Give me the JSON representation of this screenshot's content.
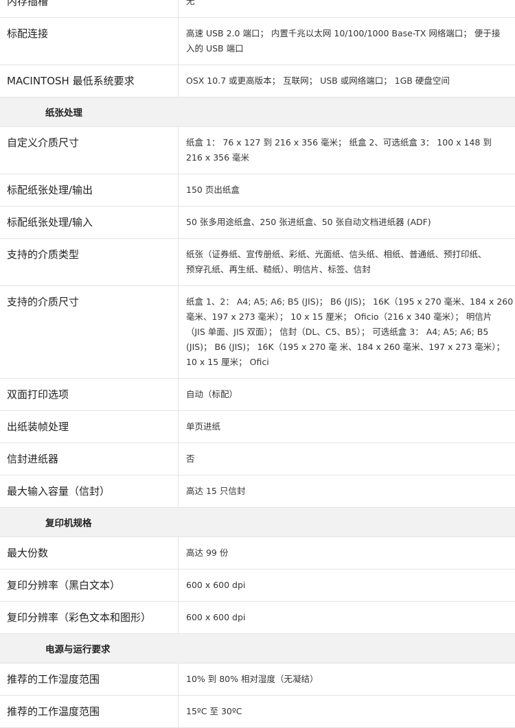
{
  "rows": [
    {
      "type": "item",
      "label": "内存插槽",
      "value": "无"
    },
    {
      "type": "item",
      "label": "标配连接",
      "value": "高速 USB 2.0 端口； 内置千兆以太网 10/100/1000 Base-TX 网络端口； 便于接\n入的 USB 端口"
    },
    {
      "type": "item",
      "label": "MACINTOSH 最低系统要求",
      "value": "OSX 10.7 或更高版本； 互联网； USB 或网络端口； 1GB 硬盘空间"
    },
    {
      "type": "section",
      "title": "纸张处理"
    },
    {
      "type": "item",
      "label": "自定义介质尺寸",
      "value": "纸盒 1： 76 x 127 到 216 x 356 毫米； 纸盒 2、可选纸盒 3： 100 x 148 到\n216 x 356 毫米"
    },
    {
      "type": "item",
      "label": "标配纸张处理/输出",
      "value": "150 页出纸盒"
    },
    {
      "type": "item",
      "label": "标配纸张处理/输入",
      "value": "50 张多用途纸盒、250 张进纸盒、50 张自动文档进纸器 (ADF)"
    },
    {
      "type": "item",
      "label": "支持的介质类型",
      "value": "纸张（证券纸、宣传册纸、彩纸、光面纸、信头纸、相纸、普通纸、预打印纸、\n预穿孔纸、再生纸、糙纸）、明信片、标签、信封"
    },
    {
      "type": "item",
      "label": "支持的介质尺寸",
      "value": "纸盒 1、2： A4; A5; A6; B5 (JIS)； B6 (JIS)； 16K（195 x 270 毫米、184 x 260\n毫米、197 x 273 毫米）； 10 x 15 厘米； Oficio（216 x 340 毫米）； 明信片\n（JIS 单面、JIS 双面）； 信封（DL、C5、B5）； 可选纸盒 3： A4; A5; A6; B5\n(JIS)； B6 (JIS)； 16K（195 x 270 毫 米、184 x 260 毫米、197 x 273 毫米）；\n10 x 15 厘米； Ofici"
    },
    {
      "type": "item",
      "label": "双面打印选项",
      "value": "自动（标配）"
    },
    {
      "type": "item",
      "label": "出纸装帧处理",
      "value": "单页进纸"
    },
    {
      "type": "item",
      "label": "信封进纸器",
      "value": "否"
    },
    {
      "type": "item",
      "label": "最大输入容量（信封）",
      "value": "高达 15 只信封"
    },
    {
      "type": "section",
      "title": "复印机规格"
    },
    {
      "type": "item",
      "label": "最大份数",
      "value": "高达 99 份"
    },
    {
      "type": "item",
      "label": "复印分辨率（黑白文本）",
      "value": "600 x 600 dpi"
    },
    {
      "type": "item",
      "label": "复印分辨率（彩色文本和图形）",
      "value": "600 x 600 dpi"
    },
    {
      "type": "section",
      "title": "电源与运行要求"
    },
    {
      "type": "item",
      "label": "推荐的工作湿度范围",
      "value": "10% 到 80% 相对湿度（无凝结）"
    },
    {
      "type": "item",
      "label": "推荐的工作温度范围",
      "value": "15ºC 至 30ºC"
    }
  ]
}
